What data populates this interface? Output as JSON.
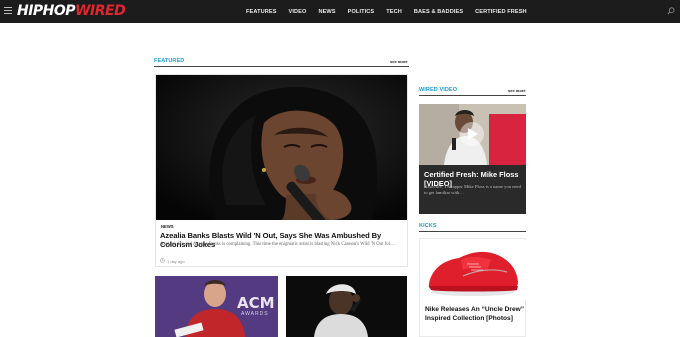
{
  "site": {
    "logo_part1": "HIPHOP",
    "logo_part2": "WIRED"
  },
  "nav": {
    "items": [
      "FEATURES",
      "VIDEO",
      "NEWS",
      "POLITICS",
      "TECH",
      "BAES & BADDIES",
      "CERTIFIED FRESH"
    ]
  },
  "featured": {
    "section_title": "FEATURED",
    "see_more": "see more",
    "main": {
      "category": "NEWS",
      "title": "Azealia Banks Blasts Wild 'N Out, Says She Was Ambushed By Colorism Jokes",
      "excerpt": "Another day and Azealia Banks is complaining. This time the enigmatic artist is blasting Nick Cannon's Wild 'N Out for…",
      "time": "1 day ago"
    }
  },
  "wired_video": {
    "section_title": "WIRED VIDEO",
    "see_more": "see more",
    "title": "Certified Fresh: Mike Floss [VIDEO]",
    "excerpt": "Nashville, TN rapper Mike Floss is a name you need to get familiar with…"
  },
  "kicks": {
    "section_title": "KICKS",
    "title": "Nike Releases An “Uncle Drew” Inspired Collection [Photos]"
  },
  "thumbs": {
    "acm_text": "ACM",
    "awards_text": "AWARDS"
  },
  "colors": {
    "topbar": "#1c1c1c",
    "accent": "#1e9bd7",
    "brand_red": "#e0262f"
  }
}
